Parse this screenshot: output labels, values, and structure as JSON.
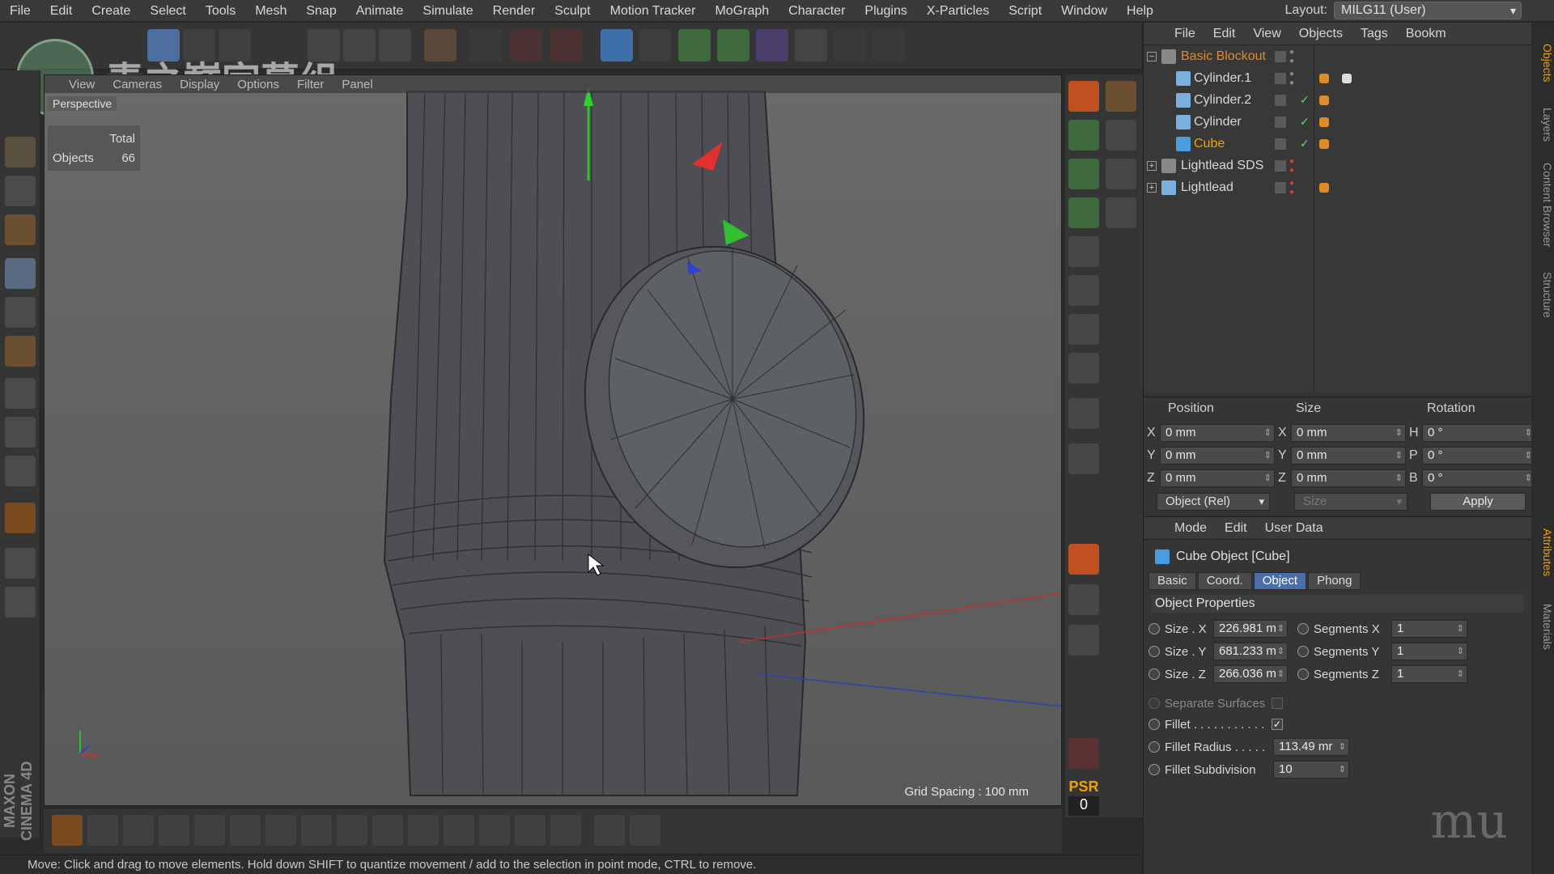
{
  "menubar": {
    "items": [
      "File",
      "Edit",
      "Create",
      "Select",
      "Tools",
      "Mesh",
      "Snap",
      "Animate",
      "Simulate",
      "Render",
      "Sculpt",
      "Motion Tracker",
      "MoGraph",
      "Character",
      "Plugins",
      "X-Particles",
      "Script",
      "Window",
      "Help"
    ],
    "layout_label": "Layout:",
    "layout_value": "MILG11 (User)"
  },
  "watermark": {
    "text": "青之巅字幕组"
  },
  "viewport": {
    "menu": [
      "View",
      "Cameras",
      "Display",
      "Options",
      "Filter",
      "Panel"
    ],
    "camera_label": "Perspective",
    "stats_header": "Total",
    "stats_label": "Objects",
    "stats_value": "66",
    "grid_spacing": "Grid Spacing : 100 mm"
  },
  "psr": {
    "label": "PSR",
    "value": "0"
  },
  "brand": "MAXON CINEMA 4D",
  "status": "Move: Click and drag to move elements. Hold down SHIFT to quantize movement / add to the selection in point mode, CTRL to remove.",
  "objects_panel": {
    "menu": [
      "File",
      "Edit",
      "View",
      "Objects",
      "Tags",
      "Bookm"
    ],
    "items": [
      {
        "name": "Basic Blockout",
        "color": "#e08a2a",
        "indent": 0
      },
      {
        "name": "Cylinder.1",
        "color": "#d8d8d8",
        "indent": 1
      },
      {
        "name": "Cylinder.2",
        "color": "#d8d8d8",
        "indent": 1
      },
      {
        "name": "Cylinder",
        "color": "#d8d8d8",
        "indent": 1
      },
      {
        "name": "Cube",
        "color": "#f0a000",
        "indent": 1
      },
      {
        "name": "Lightlead SDS",
        "color": "#d8d8d8",
        "indent": 0
      },
      {
        "name": "Lightlead",
        "color": "#d8d8d8",
        "indent": 0
      }
    ]
  },
  "coords": {
    "headers": [
      "Position",
      "Size",
      "Rotation"
    ],
    "pos": {
      "x": "0 mm",
      "y": "0 mm",
      "z": "0 mm"
    },
    "size": {
      "x": "0 mm",
      "y": "0 mm",
      "z": "0 mm"
    },
    "rot": {
      "h": "0 °",
      "p": "0 °",
      "b": "0 °"
    },
    "axis_labels": {
      "x": "X",
      "y": "Y",
      "z": "Z",
      "h": "H",
      "p": "P",
      "b": "B"
    },
    "mode": "Object (Rel)",
    "size_mode": "Size",
    "apply": "Apply"
  },
  "attributes": {
    "menu": [
      "Mode",
      "Edit",
      "User Data"
    ],
    "title": "Cube Object [Cube]",
    "tabs": [
      "Basic",
      "Coord.",
      "Object",
      "Phong"
    ],
    "active_tab": "Object",
    "section": "Object Properties",
    "size_x_label": "Size . X",
    "size_x": "226.981 m",
    "size_y_label": "Size . Y",
    "size_y": "681.233 m",
    "size_z_label": "Size . Z",
    "size_z": "266.036 m",
    "seg_x_label": "Segments X",
    "seg_x": "1",
    "seg_y_label": "Segments Y",
    "seg_y": "1",
    "seg_z_label": "Segments Z",
    "seg_z": "1",
    "separate_label": "Separate Surfaces",
    "fillet_label": "Fillet . . . . . . . . . . .",
    "fillet_radius_label": "Fillet Radius . . . . .",
    "fillet_radius": "113.49 mr",
    "fillet_sub_label": "Fillet Subdivision",
    "fillet_sub": "10"
  },
  "sidetabs": [
    "Objects",
    "Layers",
    "Content Browser",
    "Structure",
    "Attributes",
    "Materials"
  ],
  "colors": {
    "accent": "#f0a000",
    "selected_tab": "#4a6fa8"
  }
}
